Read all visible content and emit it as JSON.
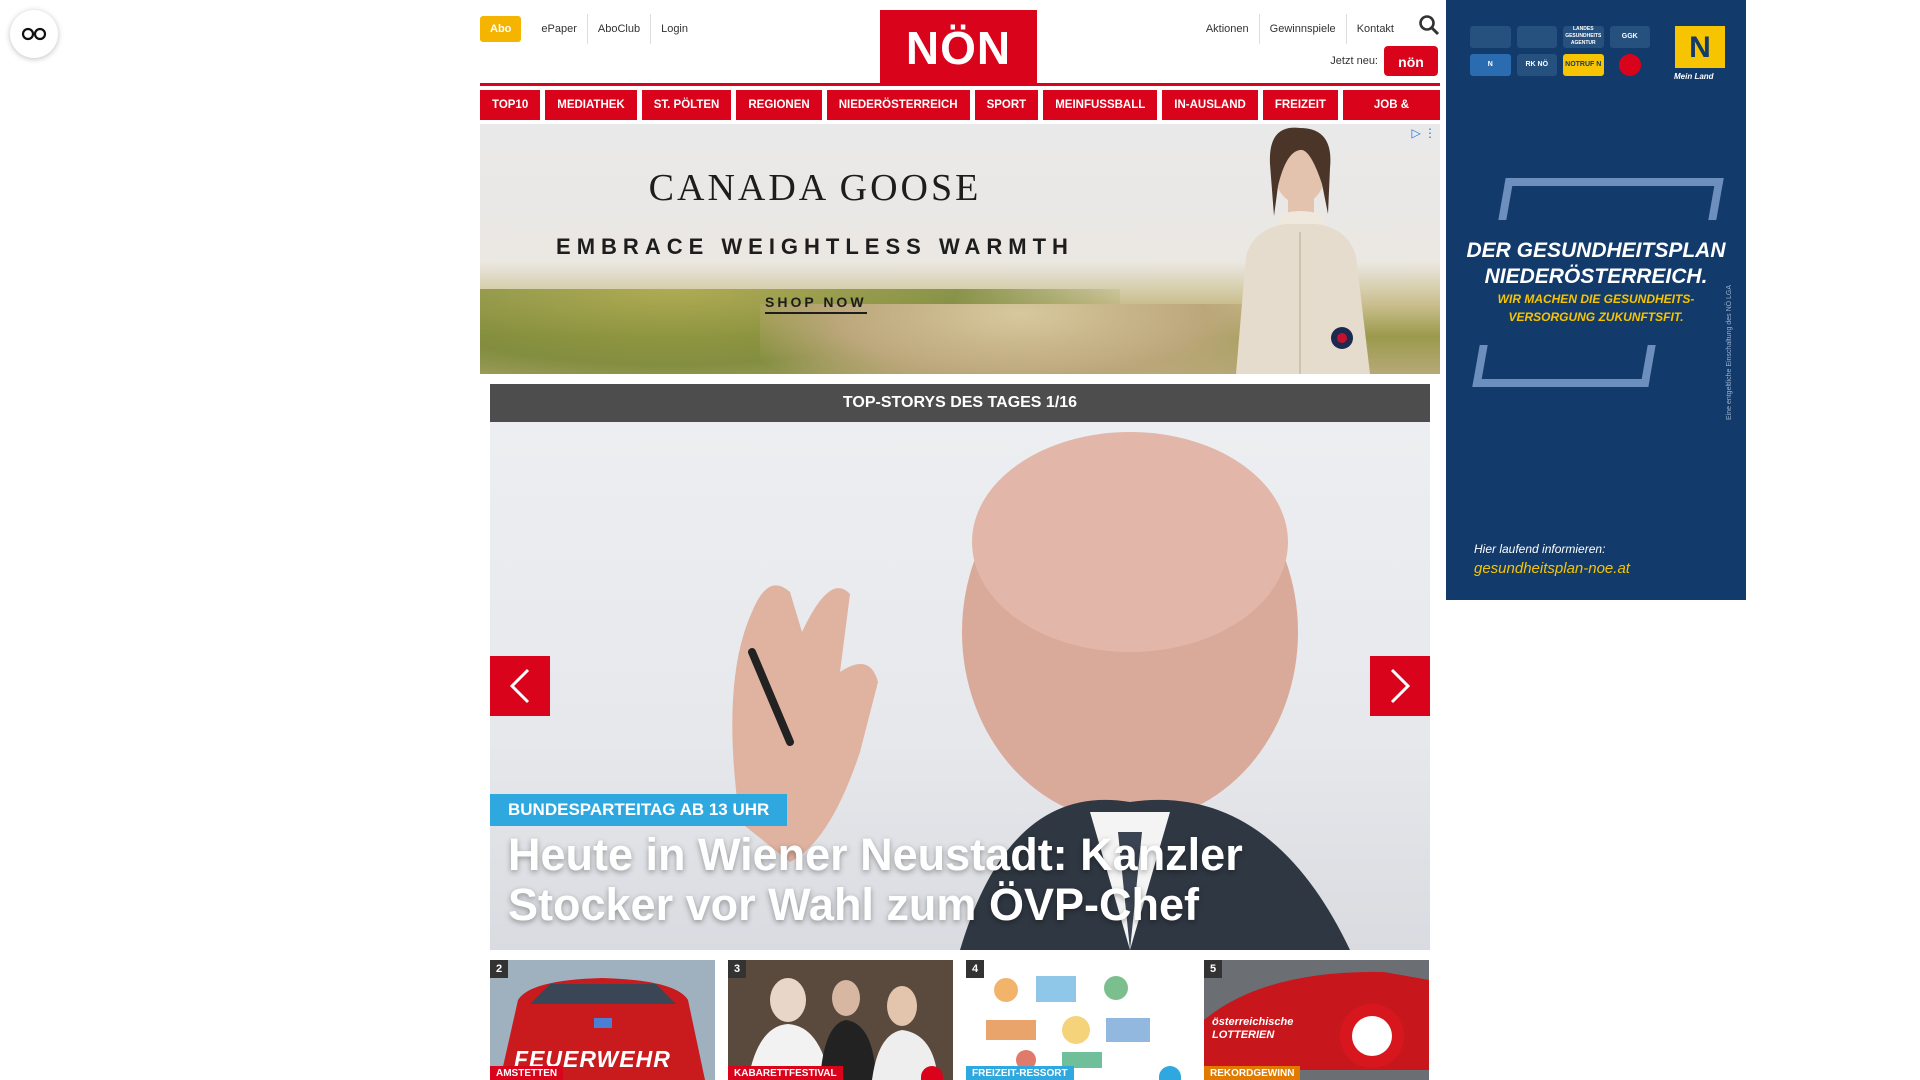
{
  "header": {
    "abo_label": "Abo",
    "links": [
      "ePaper",
      "AboClub",
      "Login"
    ],
    "logo_text": "NÖN",
    "right_links": [
      "Aktionen",
      "Gewinnspiele",
      "Kontakt"
    ],
    "jetzt_label": "Jetzt neu:",
    "jetzt_badge": "nön"
  },
  "nav": {
    "items": [
      "TOP10",
      "MEDIATHEK",
      "ST. PÖLTEN",
      "REGIONEN",
      "NIEDERÖSTERREICH",
      "SPORT",
      "MEINFUSSBALL",
      "IN-AUSLAND",
      "FREIZEIT",
      "JOB & KARRIERE"
    ]
  },
  "ad": {
    "brand": "CANADA GOOSE",
    "tagline": "EMBRACE WEIGHTLESS WARMTH",
    "cta": "SHOP NOW"
  },
  "carousel": {
    "header": "TOP-STORYS DES TAGES 1/16",
    "kicker": "BUNDESPARTEITAG AB 13 UHR",
    "headline": "Heute in Wiener Neustadt: Kanzler Stocker vor Wahl zum ÖVP-Chef"
  },
  "thumbs": [
    {
      "num": "2",
      "tag": "AMSTETTEN",
      "tag_color": "#d9041c",
      "caption": "FEUERWEHR"
    },
    {
      "num": "3",
      "tag": "KABARETTFESTIVAL",
      "tag_color": "#d9041c"
    },
    {
      "num": "4",
      "tag": "FREIZEIT-RESSORT",
      "tag_color": "#2fa8e0"
    },
    {
      "num": "5",
      "tag": "REKORDGEWINN",
      "tag_color": "#e07b00",
      "caption": "österreichische LOTTERIEN"
    }
  ],
  "side_ad": {
    "logos": [
      "",
      "",
      "LANDES GESUNDHEITS AGENTUR",
      "GGK",
      "N",
      "RK NÖ",
      "NOTRUF N",
      ""
    ],
    "n_letter": "N",
    "n_label": "Mein Land",
    "title": "DER GESUNDHEITSPLAN NIEDERÖSTERREICH.",
    "subtitle": "WIR MACHEN DIE GESUNDHEITS- VERSORGUNG ZUKUNFTSFIT.",
    "info": "Hier laufend informieren:",
    "url": "gesundheitsplan-noe.at",
    "vertical": "Eine entgeltliche Einschaltung des NÖ LGA"
  },
  "colors": {
    "brand_red": "#d9041c",
    "abo_yellow": "#f5b400",
    "kicker_blue": "#2fa8e0",
    "side_navy": "#123a6b"
  }
}
